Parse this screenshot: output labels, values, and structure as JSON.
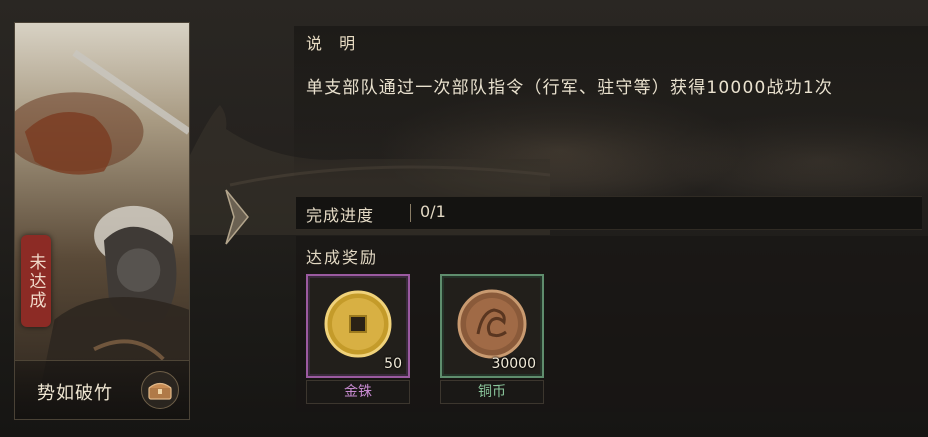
{
  "card": {
    "name": "势如破竹",
    "status": "未达成",
    "chest_icon": "treasure-chest-icon"
  },
  "panel": {
    "title": "说 明",
    "description": "单支部队通过一次部队指令（行军、驻守等）获得10000战功1次",
    "progress_label": "完成进度",
    "progress_value": "0/1",
    "rewards_title": "达成奖励"
  },
  "rewards": [
    {
      "name": "金铢",
      "quantity": "50",
      "icon": "gold-coin-icon",
      "rarity_color": "#9b5aa0"
    },
    {
      "name": "铜币",
      "quantity": "30000",
      "icon": "copper-coin-icon",
      "rarity_color": "#5f8d6d"
    }
  ],
  "nav": {
    "next_icon": "chevron-right-icon"
  }
}
